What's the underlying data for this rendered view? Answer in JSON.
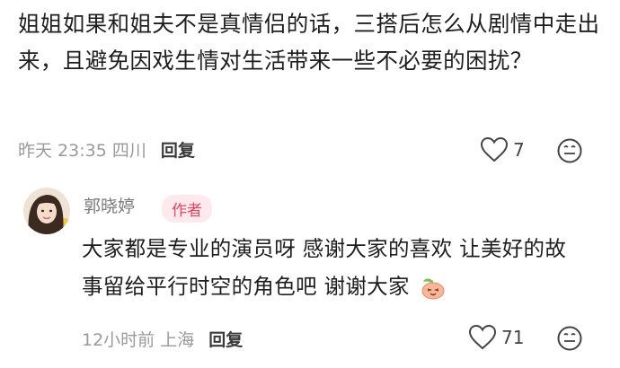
{
  "comment": {
    "text": "姐姐如果和姐夫不是真情侣的话，三搭后怎么从剧情中走出来，且避免因戏生情对生活带来一些不必要的困扰？",
    "time": "昨天 23:35",
    "location": "四川",
    "reply_label": "回复",
    "likes": "7",
    "icons": {
      "like": "heart-outline-icon",
      "react": "emoji-face-icon"
    }
  },
  "reply": {
    "username": "郭晓婷",
    "badge": "作者",
    "text": "大家都是专业的演员呀 感谢大家的喜欢 让美好的故事留给平行时空的角色吧 谢谢大家",
    "inline_emoji": "peach-face-emoji",
    "time": "12小时前",
    "location": "上海",
    "reply_label": "回复",
    "likes": "71",
    "icons": {
      "like": "heart-outline-icon",
      "react": "emoji-face-icon"
    }
  },
  "colors": {
    "badge_bg": "#fde9ee",
    "badge_text": "#e8465f",
    "meta": "#9a9a9a"
  }
}
